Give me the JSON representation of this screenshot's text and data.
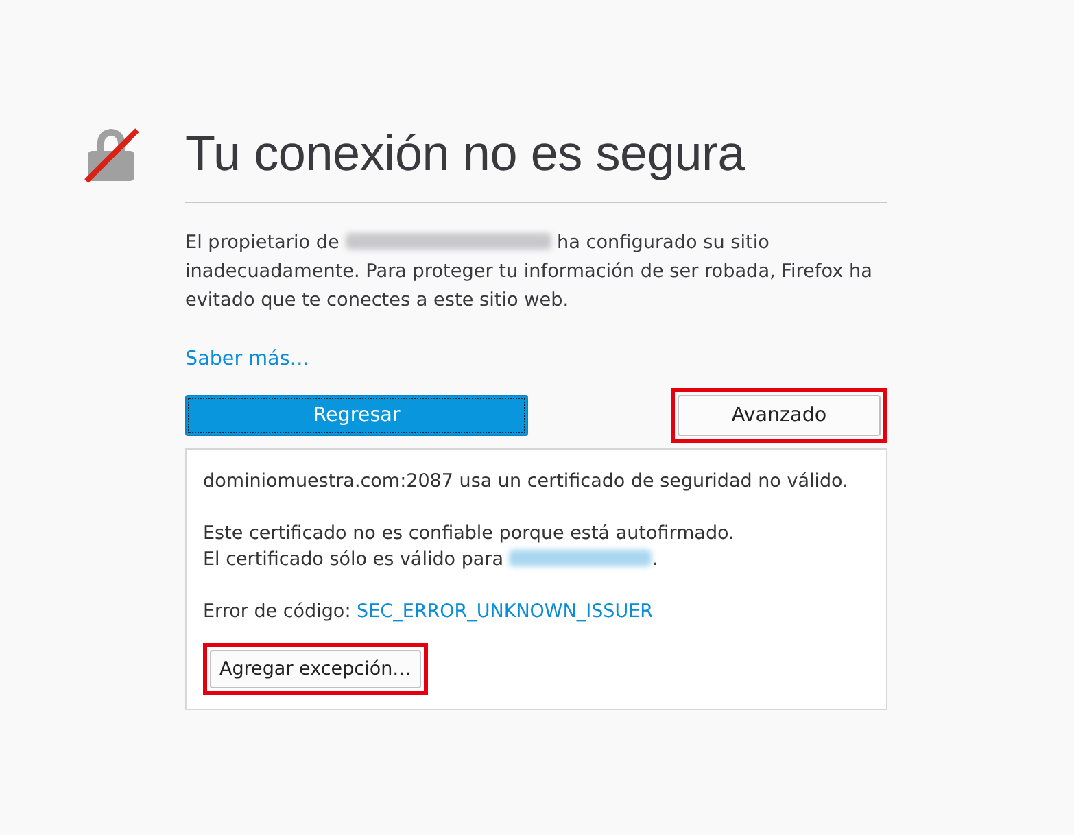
{
  "title": "Tu conexión no es segura",
  "intro": [
    {
      "kind": "text",
      "text": "El propietario de "
    },
    {
      "kind": "redacted"
    },
    {
      "kind": "text",
      "text": " ha configurado su sitio inadecuadamente. Para proteger tu información de ser robada, Firefox ha evitado que te conectes a este sitio web."
    }
  ],
  "learn_more": "Saber más…",
  "buttons": [
    {
      "label": "Regresar",
      "kind": "primary",
      "highlighted": false
    },
    {
      "label": "Avanzado",
      "kind": "secondary",
      "highlighted": true
    }
  ],
  "advanced": {
    "line1": "dominiomuestra.com:2087 usa un certificado de seguridad no válido.",
    "line2": "Este certificado no es confiable porque está autofirmado.",
    "line3": [
      {
        "kind": "text",
        "text": "El certificado sólo es válido para "
      },
      {
        "kind": "redacted_link"
      },
      {
        "kind": "text",
        "text": "."
      }
    ],
    "error_label": "Error de código:",
    "error_code": "SEC_ERROR_UNKNOWN_ISSUER",
    "exception_button": {
      "label": "Agregar excepción…",
      "highlighted": true
    }
  }
}
